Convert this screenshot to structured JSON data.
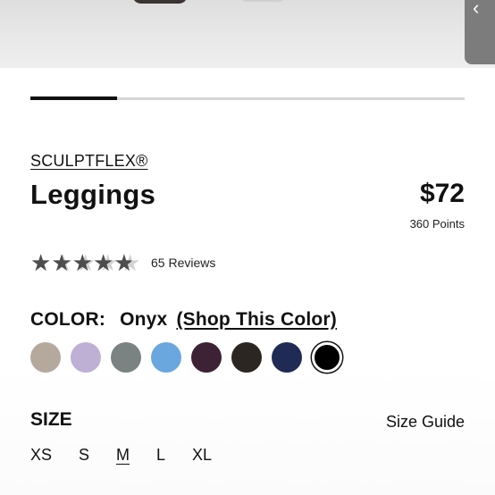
{
  "product": {
    "brand": "SCULPTFLEX®",
    "title": "Leggings",
    "price": "$72",
    "points": "360 Points"
  },
  "gallery": {
    "progress": 0.2,
    "track_color": "#d6d6d6",
    "active_color": "#111111"
  },
  "rating": {
    "value": 4.5,
    "max": 5,
    "reviews_label": "65 Reviews"
  },
  "color": {
    "label": "COLOR:",
    "selected_name": "Onyx",
    "shop_link": "(Shop This Color)",
    "swatches": [
      {
        "hex": "#b5a99e"
      },
      {
        "hex": "#bdb0d4"
      },
      {
        "hex": "#7a8382"
      },
      {
        "hex": "#6aa7df"
      },
      {
        "hex": "#3d2235"
      },
      {
        "hex": "#2c2623"
      },
      {
        "hex": "#1f2a55"
      },
      {
        "hex": "#000000",
        "selected": true
      }
    ]
  },
  "size": {
    "label": "SIZE",
    "guide_label": "Size Guide",
    "options": [
      "XS",
      "S",
      "M",
      "L",
      "XL"
    ],
    "current": "M"
  },
  "icons": {
    "hero_nav": "chevron-left-icon",
    "star": "star-icon"
  }
}
